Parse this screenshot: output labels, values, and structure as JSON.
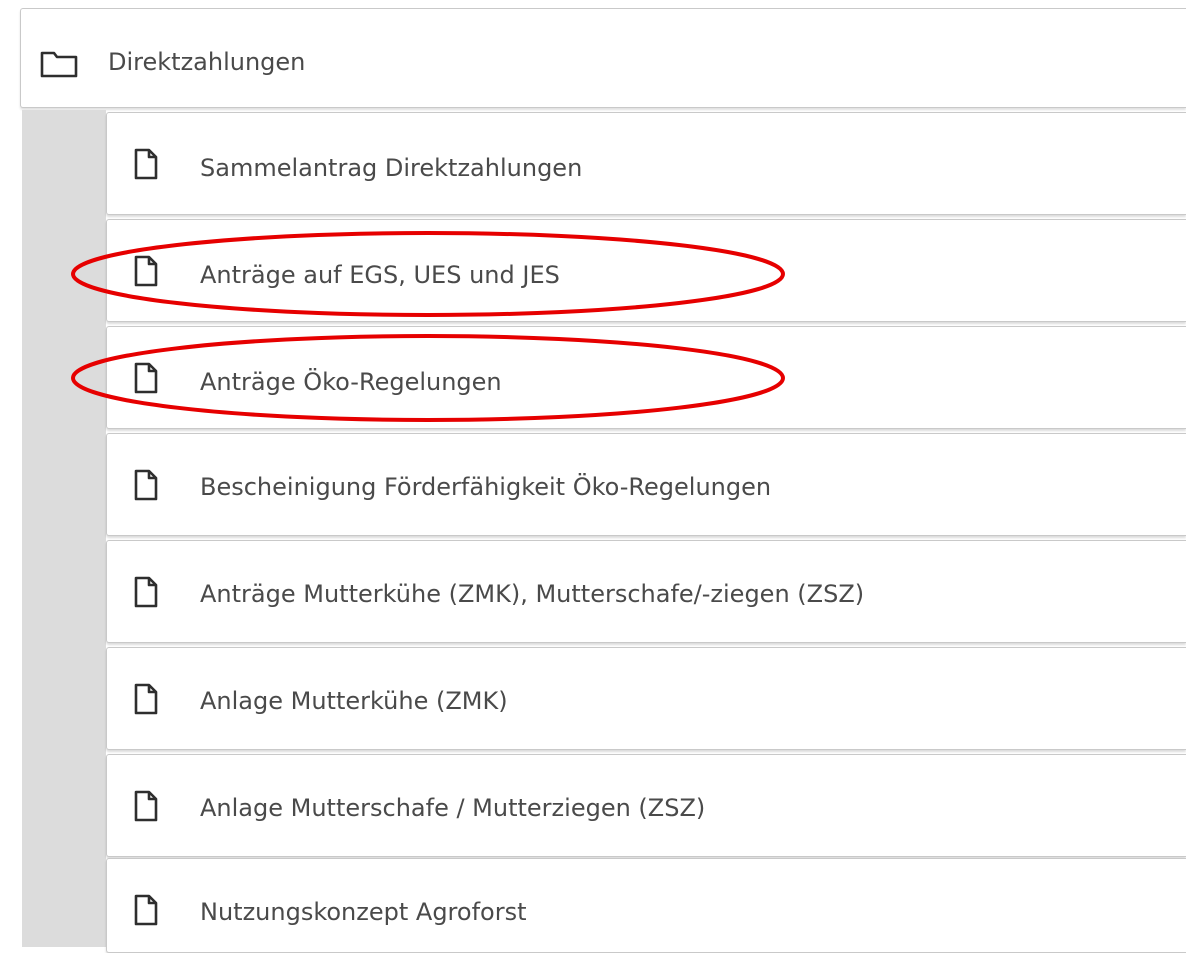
{
  "folder": {
    "icon": "folder-icon",
    "label": "Direktzahlungen"
  },
  "documents": [
    {
      "icon": "file-icon",
      "label": "Sammelantrag Direktzahlungen"
    },
    {
      "icon": "file-icon",
      "label": "Anträge auf EGS, UES und JES",
      "highlighted": true
    },
    {
      "icon": "file-icon",
      "label": "Anträge Öko-Regelungen",
      "highlighted": true
    },
    {
      "icon": "file-icon",
      "label": "Bescheinigung Förderfähigkeit Öko-Regelungen"
    },
    {
      "icon": "file-icon",
      "label": "Anträge Mutterkühe (ZMK), Mutterschafe/-ziegen (ZSZ)"
    },
    {
      "icon": "file-icon",
      "label": "Anlage Mutterkühe (ZMK)"
    },
    {
      "icon": "file-icon",
      "label": "Anlage Mutterschafe / Mutterziegen (ZSZ)"
    },
    {
      "icon": "file-icon",
      "label": "Nutzungskonzept Agroforst"
    }
  ],
  "colors": {
    "highlight": "#e60000",
    "indent": "#dcdcdc",
    "border": "#c9c9c9",
    "text": "#4a4a4a"
  }
}
